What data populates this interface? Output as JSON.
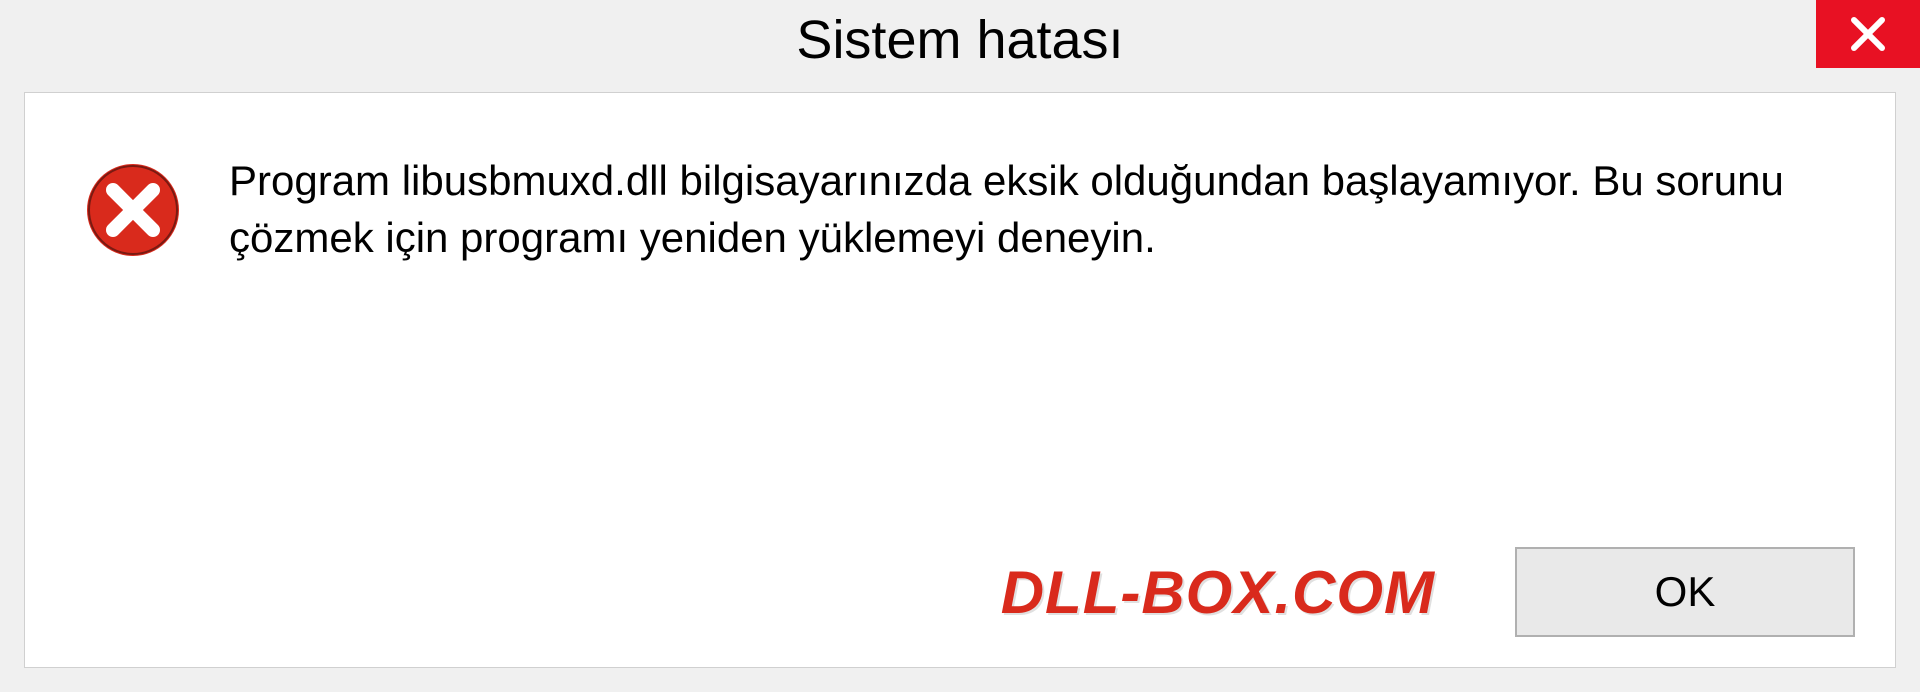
{
  "dialog": {
    "title": "Sistem hatası",
    "message": "Program libusbmuxd.dll bilgisayarınızda eksik olduğundan başlayamıyor. Bu sorunu çözmek için programı yeniden yüklemeyi deneyin.",
    "ok_label": "OK"
  },
  "branding": {
    "watermark": "DLL-BOX.COM"
  },
  "icons": {
    "close": "close-icon",
    "error": "error-icon"
  },
  "colors": {
    "close_bg": "#e81123",
    "error_icon": "#d92a1c",
    "watermark": "#d92a1c"
  }
}
